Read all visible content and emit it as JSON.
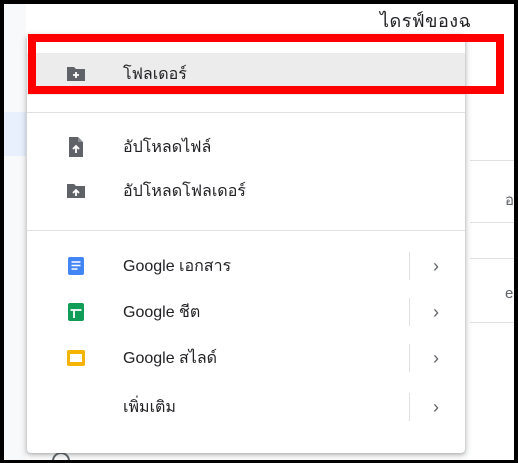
{
  "background": {
    "title_partial": "ไดรฟ์ของฉ",
    "text_snippets": [
      "อ",
      "e"
    ]
  },
  "menu": {
    "items": [
      {
        "label": "โฟลเดอร์",
        "icon": "new-folder-icon"
      },
      {
        "label": "อัปโหลดไฟล์",
        "icon": "file-upload-icon"
      },
      {
        "label": "อัปโหลดโฟลเดอร์",
        "icon": "folder-upload-icon"
      },
      {
        "label": "Google เอกสาร",
        "icon": "google-docs-icon",
        "submenu": true
      },
      {
        "label": "Google ชีต",
        "icon": "google-sheets-icon",
        "submenu": true
      },
      {
        "label": "Google สไลด์",
        "icon": "google-slides-icon",
        "submenu": true
      },
      {
        "label": "เพิ่มเติม",
        "icon": "",
        "submenu": true
      }
    ],
    "chevron": "›"
  },
  "colors": {
    "annotation": "#ff0000",
    "docs_blue": "#4285f4",
    "sheets_green": "#0f9d58",
    "slides_yellow": "#f4b400",
    "icon_gray": "#5f6368"
  }
}
